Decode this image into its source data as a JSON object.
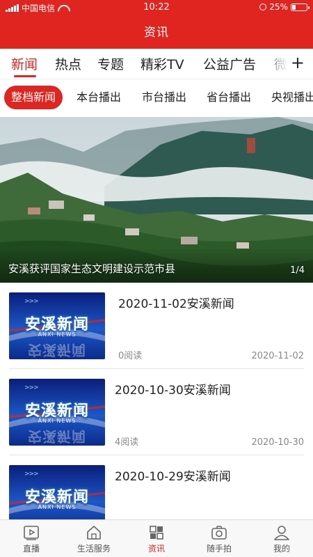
{
  "status": {
    "carrier": "中国电信",
    "time": "10:22",
    "battery": "25%",
    "battery_level": 0.25
  },
  "header": {
    "title": "资讯"
  },
  "tabs": [
    {
      "label": "新闻",
      "active": true
    },
    {
      "label": "热点"
    },
    {
      "label": "专题"
    },
    {
      "label": "精彩TV"
    },
    {
      "label": "公益广告"
    },
    {
      "label": "微"
    }
  ],
  "tabs_more_icon": "plus-icon",
  "subtabs": [
    {
      "label": "整档新闻",
      "active": true
    },
    {
      "label": "本台播出"
    },
    {
      "label": "市台播出"
    },
    {
      "label": "省台播出"
    },
    {
      "label": "央视播出"
    }
  ],
  "banner": {
    "caption": "安溪获评国家生态文明建设示范市县",
    "pager": "1/4"
  },
  "thumb": {
    "logo": "安溪新闻",
    "sub": "ANXI NEWS",
    "arrows": ">>>"
  },
  "news": [
    {
      "title": "2020-11-02安溪新闻",
      "reads": "0阅读",
      "date": "2020-11-02"
    },
    {
      "title": "2020-10-30安溪新闻",
      "reads": "4阅读",
      "date": "2020-10-30"
    },
    {
      "title": "2020-10-29安溪新闻",
      "reads": "",
      "date": ""
    }
  ],
  "bottom_nav": [
    {
      "label": "直播",
      "icon": "play-icon"
    },
    {
      "label": "生活服务",
      "icon": "home-icon"
    },
    {
      "label": "资讯",
      "icon": "grid-icon",
      "active": true
    },
    {
      "label": "随手拍",
      "icon": "camera-icon"
    },
    {
      "label": "我的",
      "icon": "user-icon"
    }
  ],
  "colors": {
    "brand": "#e02420",
    "text": "#222222",
    "muted": "#888888"
  }
}
